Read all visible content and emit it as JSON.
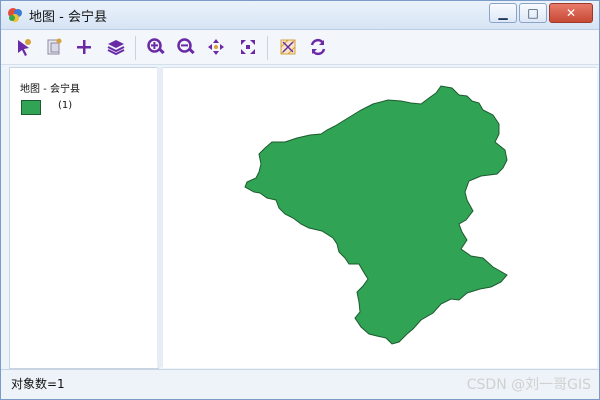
{
  "window": {
    "title": "地图 - 会宁县",
    "controls": {
      "minimize": "▁",
      "maximize": "□",
      "close": "✕"
    }
  },
  "toolbar": {
    "tools": [
      {
        "name": "select-icon",
        "glyph": "arrow"
      },
      {
        "name": "identify-icon",
        "glyph": "doc"
      },
      {
        "name": "pan-add-icon",
        "glyph": "plus"
      },
      {
        "name": "layers-icon",
        "glyph": "layers"
      },
      {
        "name": "zoom-in-icon",
        "glyph": "zoom-in"
      },
      {
        "name": "zoom-out-icon",
        "glyph": "zoom-out"
      },
      {
        "name": "pan-icon",
        "glyph": "pan"
      },
      {
        "name": "full-extent-icon",
        "glyph": "full-extent"
      },
      {
        "name": "clear-selection-icon",
        "glyph": "grid"
      },
      {
        "name": "refresh-icon",
        "glyph": "refresh"
      }
    ],
    "accent": "#6a2aa6",
    "accent_light": "#d7a23b"
  },
  "legend": {
    "title": "地图 - 会宁县",
    "items": [
      {
        "label": "(1)",
        "color": "#31a354"
      }
    ]
  },
  "map": {
    "fill": "#31a354",
    "stroke": "#1c5b2f"
  },
  "status": {
    "text": "对象数=1"
  },
  "watermark": "CSDN @刘一哥GIS"
}
